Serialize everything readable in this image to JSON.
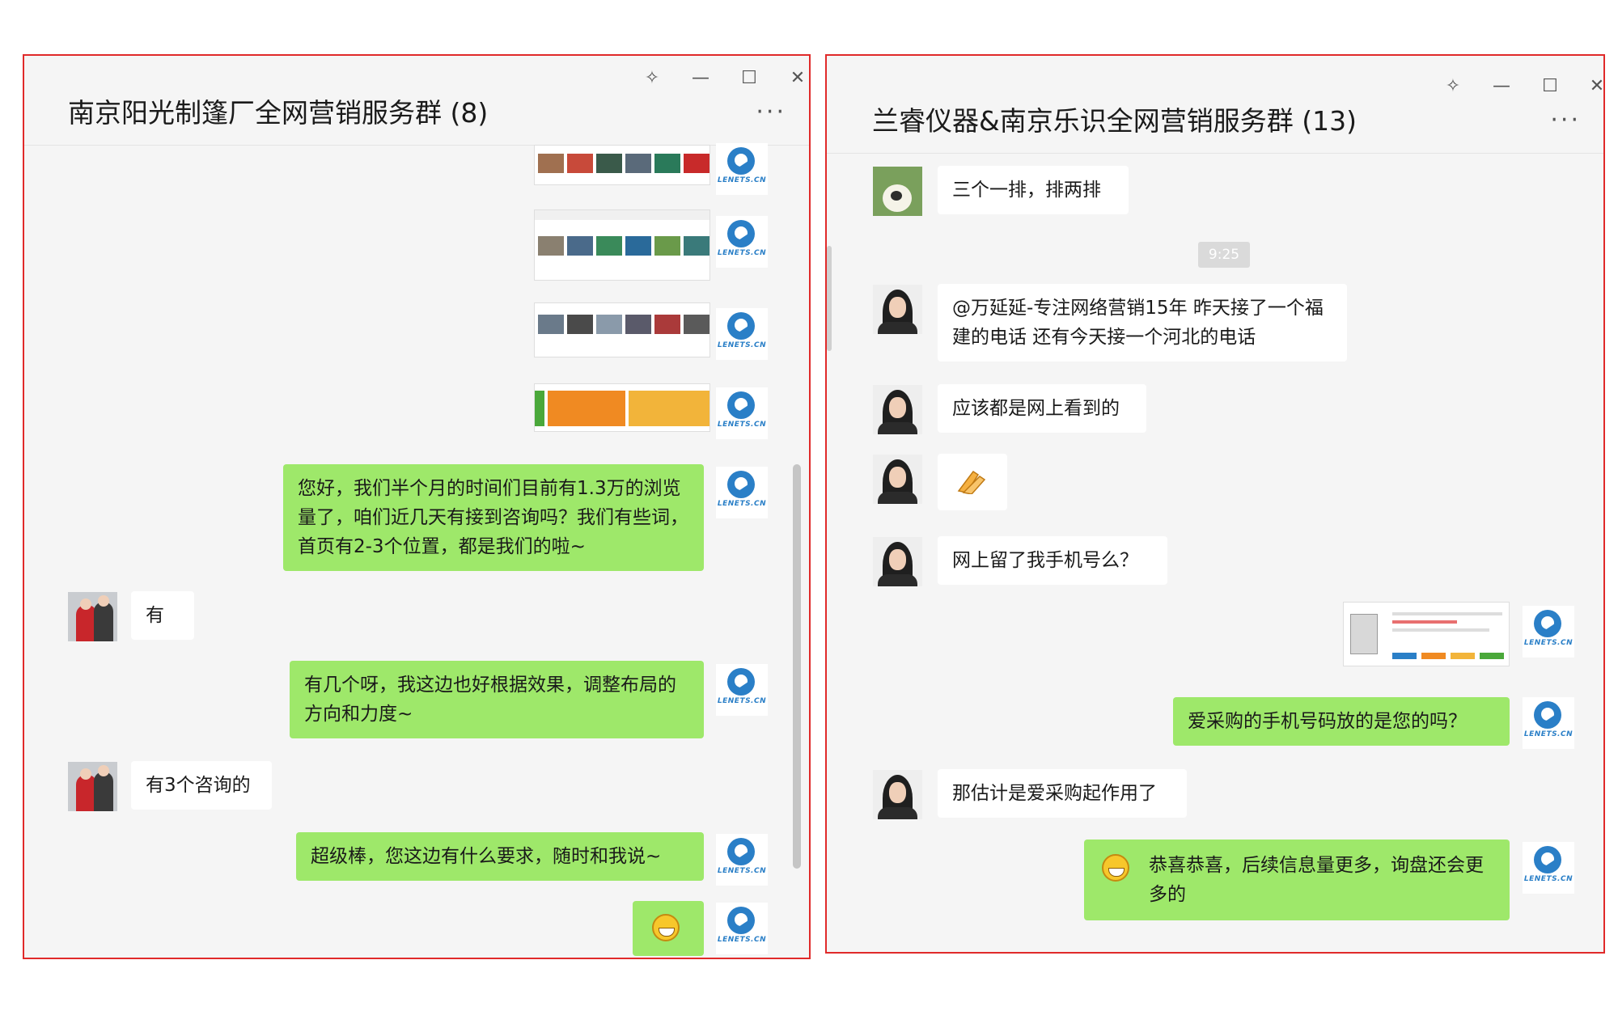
{
  "left_window": {
    "title": "南京阳光制篷厂全网营销服务群 (8)",
    "controls": {
      "pin": "✧",
      "minimize": "—",
      "maximize": "☐",
      "close": "✕"
    },
    "more": "···",
    "messages": [
      {
        "from": "self",
        "type": "image"
      },
      {
        "from": "self",
        "type": "image"
      },
      {
        "from": "self",
        "type": "image"
      },
      {
        "from": "self",
        "type": "image"
      },
      {
        "from": "self",
        "type": "text",
        "text": "您好，我们半个月的时间们目前有1.3万的浏览量了，咱们近几天有接到咨询吗？我们有些词，首页有2-3个位置，都是我们的啦~"
      },
      {
        "from": "other",
        "type": "text",
        "text": "有"
      },
      {
        "from": "self",
        "type": "text",
        "text": "有几个呀，我这边也好根据效果，调整布局的方向和力度~"
      },
      {
        "from": "other",
        "type": "text",
        "text": "有3个咨询的"
      },
      {
        "from": "self",
        "type": "text",
        "text": "超级棒，您这边有什么要求，随时和我说~"
      },
      {
        "from": "self",
        "type": "emoji"
      }
    ]
  },
  "right_window": {
    "title": "兰睿仪器&南京乐识全网营销服务群 (13)",
    "controls": {
      "pin": "✧",
      "minimize": "—",
      "maximize": "☐",
      "close": "✕"
    },
    "more": "···",
    "time_divider": "9:25",
    "messages": [
      {
        "from": "other",
        "type": "text",
        "text": "三个一排，排两排"
      },
      {
        "from": "other",
        "type": "text",
        "text": "@万延延-专注网络营销15年 昨天接了一个福建的电话 还有今天接一个河北的电话"
      },
      {
        "from": "other",
        "type": "text",
        "text": "应该都是网上看到的"
      },
      {
        "from": "other",
        "type": "emoji"
      },
      {
        "from": "other",
        "type": "text",
        "text": "网上留了我手机号么？"
      },
      {
        "from": "self",
        "type": "image"
      },
      {
        "from": "self",
        "type": "text",
        "text": "爱采购的手机号码放的是您的吗？"
      },
      {
        "from": "other",
        "type": "text",
        "text": "那估计是爱采购起作用了"
      },
      {
        "from": "self",
        "type": "text",
        "text": "恭喜恭喜，后续信息量更多，询盘还会更多的"
      }
    ]
  },
  "brand": {
    "logo_text": "LENETS.CN",
    "accent": "#2a7fc7",
    "self_bubble": "#9ee86a",
    "border": "#e02a2a"
  }
}
